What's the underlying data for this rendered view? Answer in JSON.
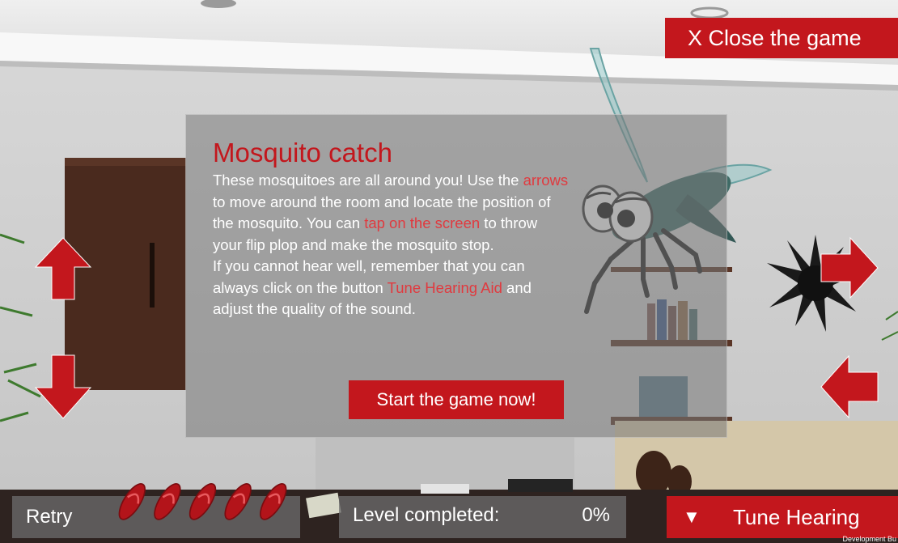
{
  "header": {
    "close_label": "X  Close the game"
  },
  "dialog": {
    "title": "Mosquito catch",
    "text_1": "These mosquitoes are all around you! Use the ",
    "hl_1": "arrows",
    "text_2": " to move around the room and locate the position of the mosquito. You can ",
    "hl_2": "tap on the screen",
    "text_3": " to throw your flip plop and make the mosquito stop.",
    "text_4": "If you cannot hear well, remember that you can always click on the button ",
    "hl_3": "Tune Hearing Aid",
    "text_5": " and adjust the quality of the sound.",
    "start_label": "Start the game now!"
  },
  "footer": {
    "retry_label": "Retry",
    "lives_remaining": 5,
    "level_label": "Level completed:",
    "level_value": "0%",
    "tune_icon": "▼",
    "tune_label": "Tune Hearing"
  },
  "watermark": "Development Bu",
  "colors": {
    "accent": "#c3171d",
    "highlight": "#e03a3f"
  },
  "icons": [
    "arrow-up-icon",
    "arrow-down-icon",
    "arrow-right-icon",
    "arrow-left-icon",
    "flip-flop-icon",
    "mosquito",
    "splat-mark"
  ]
}
